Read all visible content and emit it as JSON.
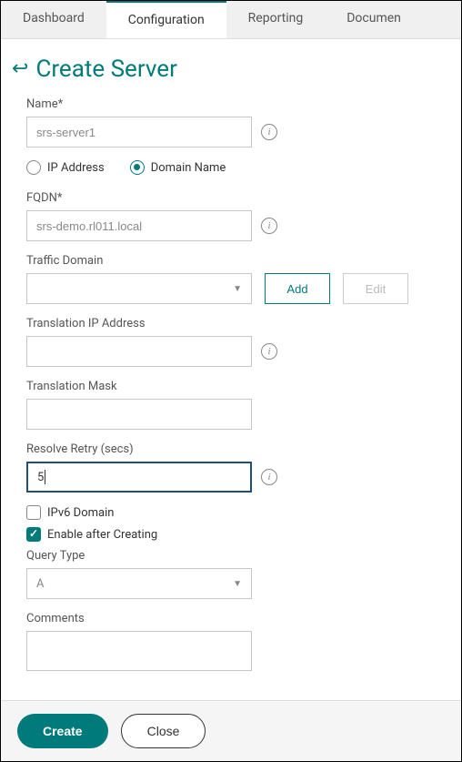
{
  "tabs": {
    "dashboard": "Dashboard",
    "configuration": "Configuration",
    "reporting": "Reporting",
    "documentation": "Documen"
  },
  "header": {
    "title": "Create Server"
  },
  "form": {
    "name_label": "Name*",
    "name_value": "srs-server1",
    "radio_ip_label": "IP Address",
    "radio_domain_label": "Domain Name",
    "fqdn_label": "FQDN*",
    "fqdn_value": "srs-demo.rl011.local",
    "traffic_domain_label": "Traffic Domain",
    "traffic_domain_value": "",
    "add_btn": "Add",
    "edit_btn": "Edit",
    "trans_ip_label": "Translation IP Address",
    "trans_ip_value": "",
    "trans_mask_label": "Translation Mask",
    "trans_mask_value": "",
    "resolve_retry_label": "Resolve Retry (secs)",
    "resolve_retry_value": "5",
    "ipv6_label": "IPv6 Domain",
    "enable_label": "Enable after Creating",
    "query_type_label": "Query Type",
    "query_type_value": "A",
    "comments_label": "Comments",
    "comments_value": ""
  },
  "footer": {
    "create_btn": "Create",
    "close_btn": "Close"
  }
}
